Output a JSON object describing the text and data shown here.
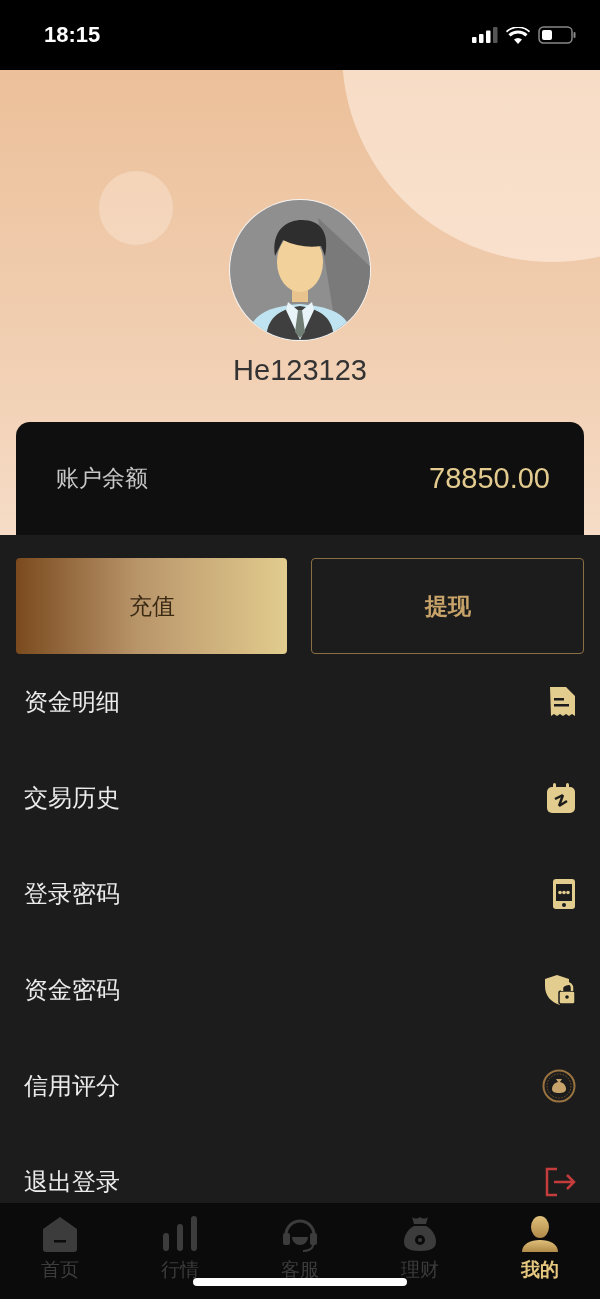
{
  "status_bar": {
    "time": "18:15"
  },
  "profile": {
    "username": "He123123"
  },
  "balance": {
    "label": "账户余额",
    "amount": "78850.00"
  },
  "actions": [
    {
      "label": "充值",
      "kind": "filled"
    },
    {
      "label": "提现",
      "kind": "outline"
    }
  ],
  "menu": [
    {
      "label": "资金明细",
      "kind": "normal"
    },
    {
      "label": "交易历史",
      "kind": "normal"
    },
    {
      "label": "登录密码",
      "kind": "normal"
    },
    {
      "label": "资金密码",
      "kind": "normal"
    },
    {
      "label": "信用评分",
      "kind": "normal"
    },
    {
      "label": "退出登录",
      "kind": "danger"
    }
  ],
  "tabs": [
    {
      "label": "首页",
      "selected": false
    },
    {
      "label": "行情",
      "selected": false
    },
    {
      "label": "客服",
      "selected": false
    },
    {
      "label": "理财",
      "selected": false
    },
    {
      "label": "我的",
      "selected": true
    }
  ]
}
